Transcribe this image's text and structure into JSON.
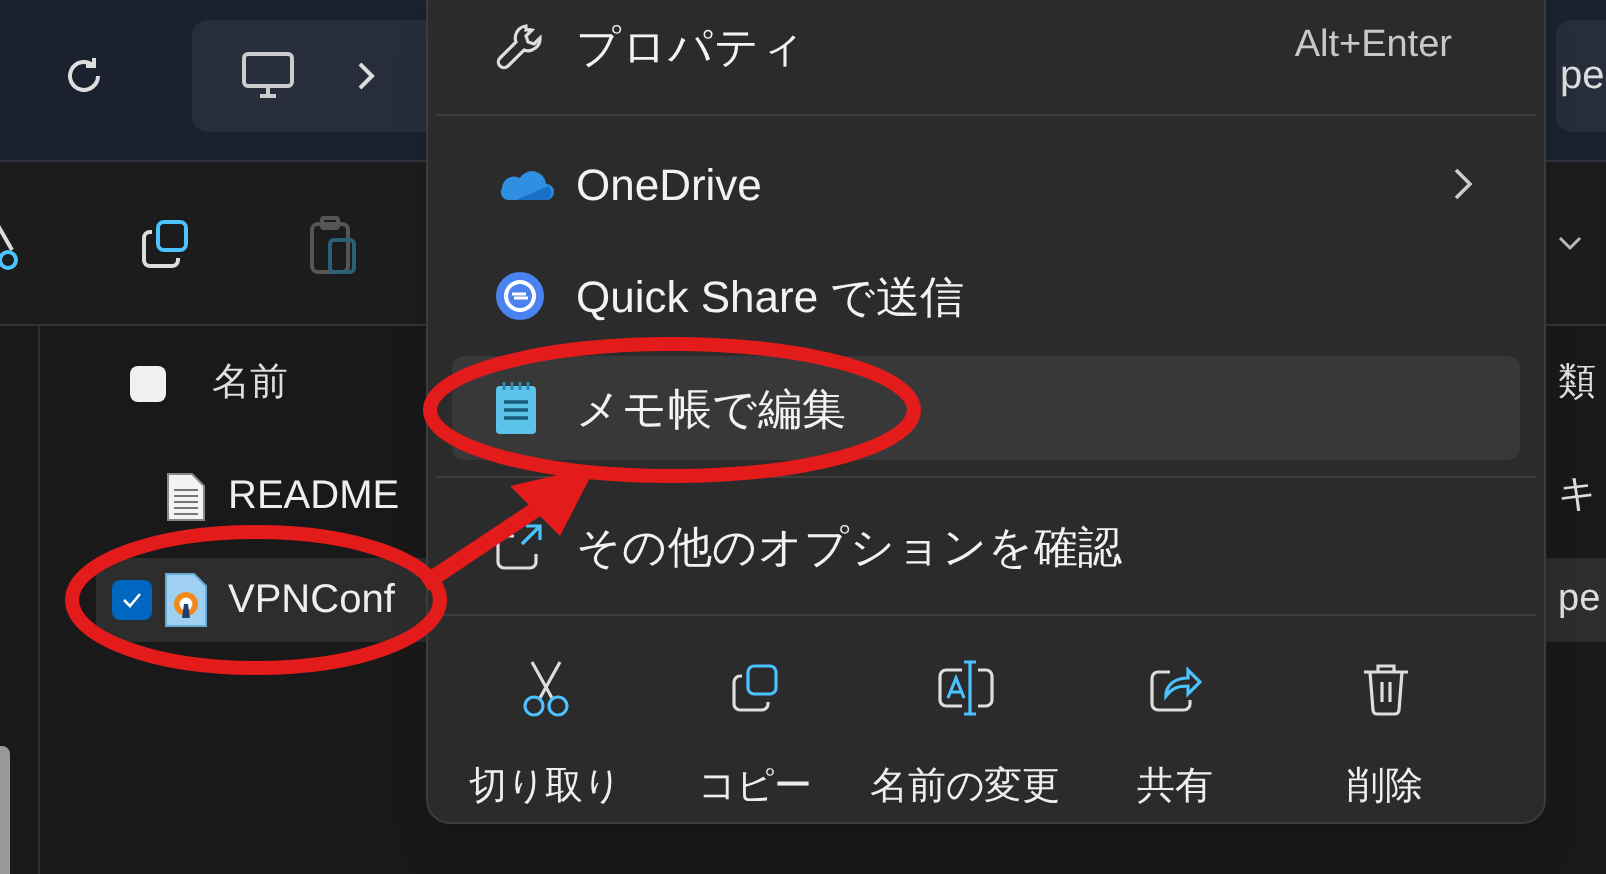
{
  "search_field": {
    "value": "pe"
  },
  "file_list": {
    "header": {
      "label": "名前",
      "checked": false,
      "type_column": "類"
    },
    "rows": [
      {
        "name": "README",
        "type_cell": "キ",
        "selected": false,
        "checked": false
      },
      {
        "name": "VPNConf",
        "type_cell": "pe",
        "selected": true,
        "checked": true
      }
    ]
  },
  "context_menu": {
    "items": [
      {
        "kind": "item",
        "label": "プロパティ",
        "shortcut": "Alt+Enter",
        "submenu": false,
        "selected": false
      },
      {
        "kind": "divider"
      },
      {
        "kind": "item",
        "label": "OneDrive",
        "submenu": true,
        "selected": false
      },
      {
        "kind": "item",
        "label": "Quick Share で送信",
        "submenu": false,
        "selected": false
      },
      {
        "kind": "item",
        "label": "メモ帳で編集",
        "submenu": false,
        "selected": true
      },
      {
        "kind": "divider"
      },
      {
        "kind": "item",
        "label": "その他のオプションを確認",
        "submenu": false,
        "selected": false
      },
      {
        "kind": "divider"
      }
    ],
    "actions": [
      {
        "label": "切り取り"
      },
      {
        "label": "コピー"
      },
      {
        "label": "名前の変更"
      },
      {
        "label": "共有"
      },
      {
        "label": "削除"
      }
    ]
  },
  "annotations": [
    {
      "kind": "menu_ellipse"
    },
    {
      "kind": "row_ellipse"
    },
    {
      "kind": "arrow"
    }
  ]
}
